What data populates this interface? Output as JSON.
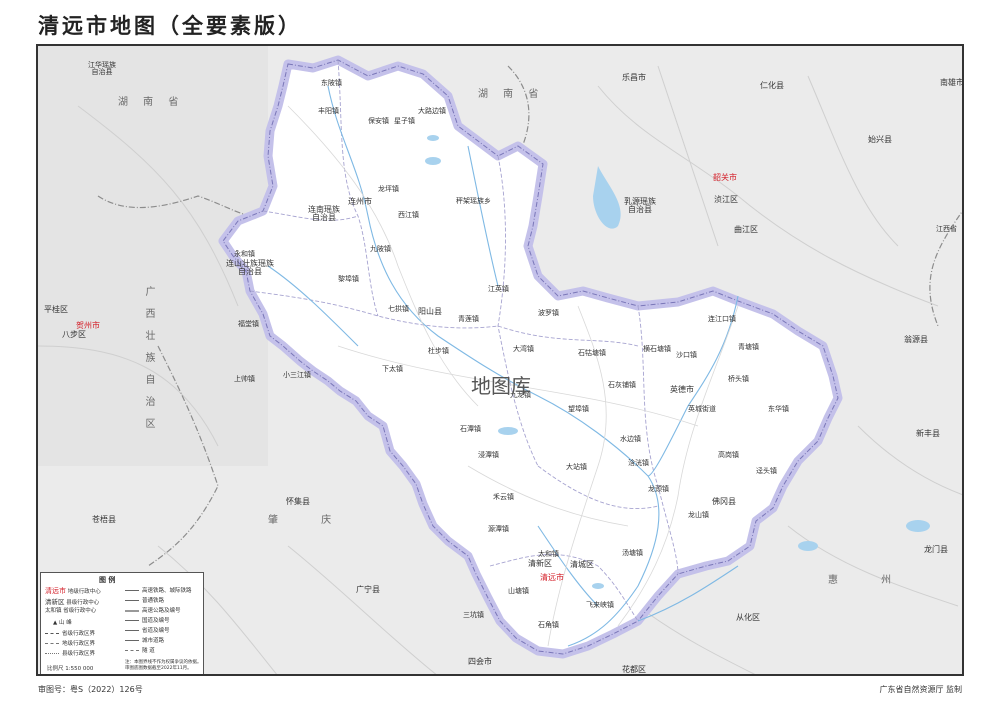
{
  "title": "清远市地图（全要素版）",
  "footer": {
    "left": "审图号：粤S（2022）126号",
    "right": "广东省自然资源厅  监制"
  },
  "watermark": "地图库",
  "colors": {
    "qingyuan_fill": "#ffffff",
    "outside_fill": "#e9e9e9",
    "boundary_halo": "#b9b6e2",
    "boundary_line": "#7a77b8",
    "water": "#a8d2ee",
    "city_red": "#d4202a"
  },
  "places": {
    "jianghua": "江华瑶族\n自治县",
    "hunan_w": "湖   南   省",
    "hunan_n": "湖 南 省",
    "lechang": "乐昌市",
    "renhua": "仁化县",
    "nanxiong": "南雄市",
    "shixing": "始兴县",
    "shaoguan": "韶关市",
    "wujiang": "浈江区",
    "ruyuan": "乳源瑶族\n自治县",
    "qujiang": "曲江区",
    "wengyuan": "翁源县",
    "jiangxi": "江西省",
    "liannan": "连南瑶族\n自治县",
    "lianzhou": "连州市",
    "lianshan": "连山壮族瑶族\n自治县",
    "yangshan": "阳山县",
    "hezhou": "贺州市",
    "babu": "八步区",
    "pingui": "平桂区",
    "guangxi": "广西壮族自治区",
    "yingde": "英德市",
    "fogang": "佛冈县",
    "qingxin": "清新区",
    "qingcheng": "清城区",
    "qingyuan": "清远市",
    "huaiji": "怀集县",
    "cangwu": "苍梧县",
    "guangning": "广宁县",
    "sihui": "四会市",
    "huadu": "花都区",
    "conghua": "从化区",
    "longmen": "龙门县",
    "xinfeng": "新丰县",
    "huangpu": "黄埔区",
    "guangdong": "广   东   省",
    "zhaoqing": "肇   庆",
    "huizhou": "惠   州"
  },
  "towns": [
    "东陂镇",
    "丰阳镇",
    "保安镇",
    "星子镇",
    "大路边镇",
    "西岸镇",
    "九陂镇",
    "龙坪镇",
    "西江镇",
    "三江镇",
    "寨岗镇",
    "香坪镇",
    "大麦山镇",
    "涡水镇",
    "秤架瑶族乡",
    "黎埠镇",
    "七拱镇",
    "太平镇",
    "江英镇",
    "青莲镇",
    "杜步镇",
    "阳城镇",
    "黄花镇",
    "大湾镇",
    "波罗镇",
    "石牯塘镇",
    "横石塘镇",
    "沙口镇",
    "望埠镇",
    "英城街道",
    "桥头镇",
    "连江口镇",
    "青塘镇",
    "白沙镇",
    "石灰铺镇",
    "九龙镇",
    "浸潭镇",
    "水边镇",
    "大站镇",
    "石潭镇",
    "三坑镇",
    "禾云镇",
    "山塘镇",
    "太和镇",
    "飞来峡镇",
    "石角镇",
    "高岗镇",
    "迳头镇",
    "汤塘镇",
    "石角镇",
    "龙山镇",
    "源潭镇",
    "石马镇",
    "上帅镇",
    "小三江镇",
    "永和镇",
    "吉田镇",
    "福堂镇",
    "大崀镇",
    "大洞镇",
    "下太镇",
    "浛洸镇",
    "西牛镇",
    "大站镇",
    "龙颈镇",
    "鱼坝镇",
    "英红镇",
    "东华镇",
    "横荷街道"
  ],
  "legend": {
    "title": "图    例",
    "items_left": [
      "省级行政中心",
      "地级行政中心",
      "县级行政中心",
      "山   峰",
      "省级行政区界",
      "地级行政区界",
      "县级行政区界"
    ],
    "items_right": [
      "高速铁路、城际铁路",
      "普通铁路",
      "高速公路及编号",
      "国道及编号",
      "省道及编号",
      "城市道路",
      "隧   道"
    ],
    "sample_city": "清远市",
    "sample_county": "清新区",
    "sample_town": "太和镇",
    "scale": "比例尺   1:550 000",
    "note": "注：本图界线不作为权属争议的依据。\n审图底图数据截至2022年11月。"
  }
}
